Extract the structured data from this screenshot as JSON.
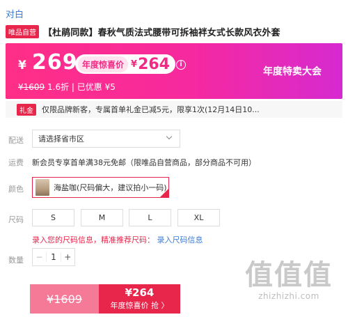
{
  "store": {
    "brand": "对白"
  },
  "product": {
    "self_operated_tag": "唯品自营",
    "title": "【杜鹃同款】春秋气质法式腰带可拆袖袢女式长款风衣外套"
  },
  "price_banner": {
    "yen": "¥",
    "price": "269",
    "surprise_label": "年度惊喜价",
    "surprise_yen": "¥",
    "surprise_price": "264",
    "info_icon": "i",
    "original_price": "¥1609",
    "discount_text": "1.6折 | 已优惠 ¥5",
    "promo_title": "年度特卖大会"
  },
  "gift": {
    "tag": "礼金",
    "text": "仅限品牌新客，专属首单礼金已减5元，限享1次(12月14日10..."
  },
  "options": {
    "delivery_label": "配送",
    "address_placeholder": "请选择省市区",
    "shipping_label": "运费",
    "shipping_text": "新会员专享首单满38元免邮（限唯品自营商品，部分商品不可用）",
    "color_label": "颜色",
    "color_value": "海盐咖(尺码偏大，建议拍小一码)",
    "size_label": "尺码",
    "sizes": [
      "S",
      "M",
      "L",
      "XL"
    ],
    "size_hint": "录入您的尺码信息，精准推荐尺码：",
    "size_link": "录入尺码信息",
    "quantity_label": "数量",
    "quantity": "1",
    "minus": "−",
    "plus": "+"
  },
  "buy": {
    "original_price": "¥1609",
    "now_price": "¥264",
    "now_label": "年度惊喜价 抢 〉"
  },
  "watermark": {
    "logo": "值值值",
    "text": "zhizhizhi.com"
  },
  "colors": {
    "accent": "#e8254b",
    "pink": "#ff2f86",
    "link": "#3a7bd5"
  }
}
